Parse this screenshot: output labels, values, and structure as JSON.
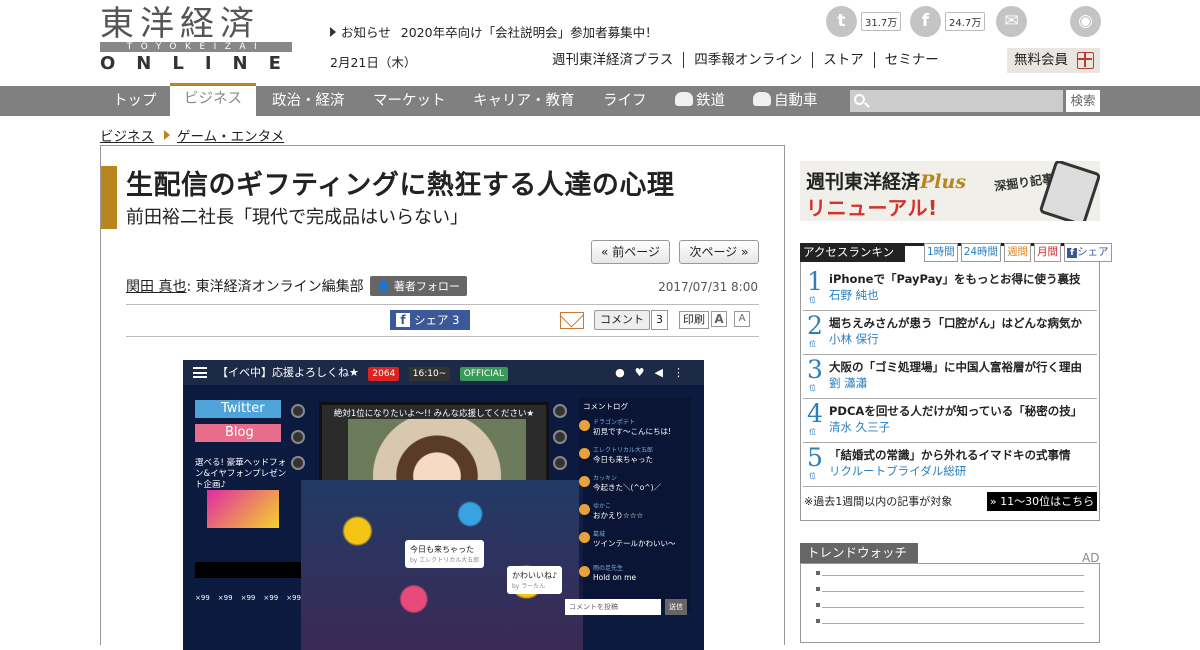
{
  "header": {
    "logo_jp": "東洋経済",
    "logo_en": "TOYOKEIZAI",
    "logo_online": "ONLINE",
    "notice_label": "お知らせ",
    "notice_text": "2020年卒向け「会社説明会」参加者募集中！",
    "date": "2月21日（木）",
    "sub_nav": [
      "週刊東洋経済プラス",
      "四季報オンライン",
      "ストア",
      "セミナー"
    ],
    "member_button": "無料会員",
    "social": {
      "twitter_count": "31.7万",
      "facebook_count": "24.7万"
    }
  },
  "nav": {
    "items": [
      "トップ",
      "ビジネス",
      "政治・経済",
      "マーケット",
      "キャリア・教育",
      "ライフ",
      "鉄道",
      "自動車"
    ],
    "active": "ビジネス",
    "search_button": "検索"
  },
  "breadcrumb": [
    "ビジネス",
    "ゲーム・エンタメ"
  ],
  "article": {
    "title": "生配信のギフティングに熱狂する人達の心理",
    "subtitle": "前田裕二社長「現代で完成品はいらない」",
    "prev_page": "« 前ページ",
    "next_page": "次ページ »",
    "author_name": "関田 真也",
    "author_org": " : 東洋経済オンライン編集部",
    "follow_button": "著者フォロー",
    "date": "2017/07/31 8:00",
    "share_label": "シェア",
    "share_count": "3",
    "comment_label": "コメント",
    "comment_count": "3",
    "print_label": "印刷",
    "font_large": "A",
    "font_small": "A"
  },
  "hero": {
    "top_title": "【イベ中】応援よろしくね★",
    "viewers": "2064",
    "time": "16:10~",
    "official": "OFFICIAL",
    "twitter": "Twitter",
    "blog": "Blog",
    "promo": "選べる! 豪華ヘッドフォン&イヤフォンプレゼント企画♪",
    "stage_caption": "絶対1位になりたいよ〜!! みんな応援してください★",
    "comment_log": "コメントログ",
    "log": [
      {
        "user": "ドラゴンポテト",
        "text": "初見です〜こんにちは!"
      },
      {
        "user": "エレクトリカル大五郎",
        "text": "今日も来ちゃった"
      },
      {
        "user": "カッキン",
        "text": "今起きた＼(^o^)／"
      },
      {
        "user": "ゆかこ",
        "text": "おかえり☆☆☆"
      },
      {
        "user": "葛城",
        "text": "ツインテールかわいい〜"
      },
      {
        "user": "雨の足先生",
        "text": "Hold on me"
      }
    ],
    "bubble1": "今日も来ちゃった",
    "bubble1_by": "by エレクトリカル大五郎",
    "bubble2": "かわいいね♪",
    "bubble2_by": "by ラーたん",
    "input_placeholder": "コメントを投稿",
    "post": "送信",
    "item_counts": [
      "×99",
      "×99",
      "×99",
      "×99",
      "×99"
    ]
  },
  "sidebar": {
    "banner_top": "週刊東洋経済",
    "banner_plus": "Plus",
    "banner_bottom": "リニューアル!",
    "banner_side": "深掘り記事満載",
    "ranking_label": "アクセスランキング",
    "ranking_tabs": [
      "1時間",
      "24時間",
      "週間",
      "月間",
      "シェア"
    ],
    "ranking": [
      {
        "rank": "1",
        "title": "iPhoneで「PayPay」をもっとお得に使う裏技",
        "author": "石野 純也"
      },
      {
        "rank": "2",
        "title": "堀ちえみさんが患う「口腔がん」はどんな病気か",
        "author": "小林 保行"
      },
      {
        "rank": "3",
        "title": "大阪の「ゴミ処理場」に中国人富裕層が行く理由",
        "author": "劉 瀟瀟"
      },
      {
        "rank": "4",
        "title": "PDCAを回せる人だけが知っている「秘密の技」",
        "author": "清水 久三子"
      },
      {
        "rank": "5",
        "title": "「結婚式の常識」から外れるイマドキの式事情",
        "author": "リクルートブライダル総研"
      }
    ],
    "rank_suffix": "位",
    "ranking_note": "※過去1週間以内の記事が対象",
    "ranking_more": "» 11～30位はこちら",
    "trend_label": "トレンドウォッチ",
    "ad": "AD"
  },
  "colors": {
    "accent": "#b8861c",
    "nav_bg": "#808080",
    "rank_blue": "#2a7fc0",
    "facebook": "#3b5998"
  }
}
